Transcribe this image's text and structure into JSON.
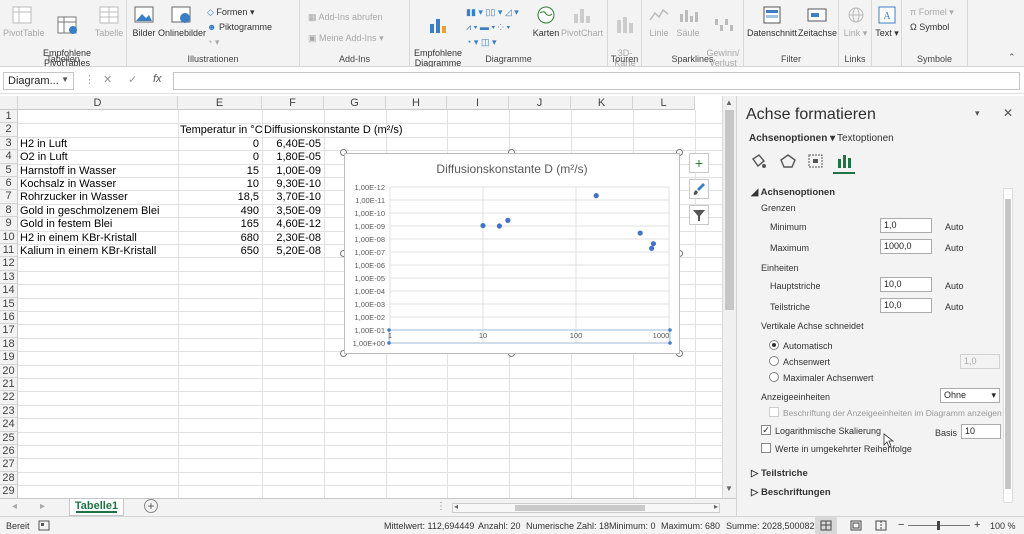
{
  "ribbon": {
    "tabellen": {
      "group": "Tabellen",
      "pivottable": "PivotTable",
      "empfohlene": "Empfohlene\nPivotTables",
      "tabelle": "Tabelle"
    },
    "illustrationen": {
      "group": "Illustrationen",
      "bilder": "Bilder",
      "onlinebilder": "Onlinebilder",
      "formen": "Formen",
      "piktogramme": "Piktogramme"
    },
    "addins": {
      "group": "Add-Ins",
      "abrufen": "Add-Ins abrufen",
      "meine": "Meine Add-Ins"
    },
    "diagramme": {
      "group": "Diagramme",
      "empfohlene": "Empfohlene\nDiagramme",
      "karten": "Karten",
      "pivotchart": "PivotChart"
    },
    "touren": {
      "group": "Touren",
      "karte3d": "3D-\nKarte"
    },
    "sparklines": {
      "group": "Sparklines",
      "linie": "Linie",
      "saeule": "Säule",
      "gewinn": "Gewinn/\nVerlust"
    },
    "filter": {
      "group": "Filter",
      "datenschnitt": "Datenschnitt",
      "zeitachse": "Zeitachse"
    },
    "links": {
      "group": "Links",
      "link": "Link"
    },
    "text": {
      "group": "",
      "text": "Text"
    },
    "symbole": {
      "group": "Symbole",
      "formel": "Formel",
      "symbol": "Symbol"
    }
  },
  "formula_bar": {
    "name_box": "Diagram...",
    "cancel": "✕",
    "enter": "✓",
    "fx": "fx",
    "value": ""
  },
  "columns": [
    "D",
    "E",
    "F",
    "G",
    "H",
    "I",
    "J",
    "K",
    "L"
  ],
  "rows": [
    "1",
    "2",
    "3",
    "4",
    "5",
    "6",
    "7",
    "8",
    "9",
    "10",
    "11",
    "12",
    "13",
    "14",
    "15",
    "16",
    "17",
    "18",
    "19",
    "20",
    "21",
    "22",
    "23",
    "24",
    "25",
    "26",
    "27",
    "28",
    "29"
  ],
  "table": {
    "header_e": "Temperatur in °C",
    "header_f": "Diffusionskonstante D (m²/s)",
    "data": [
      {
        "d": "H2 in Luft",
        "e": "0",
        "f": "6,40E-05"
      },
      {
        "d": "O2 in Luft",
        "e": "0",
        "f": "1,80E-05"
      },
      {
        "d": "Harnstoff in Wasser",
        "e": "15",
        "f": "1,00E-09"
      },
      {
        "d": "Kochsalz in Wasser",
        "e": "10",
        "f": "9,30E-10"
      },
      {
        "d": "Rohrzucker in Wasser",
        "e": "18,5",
        "f": "3,70E-10"
      },
      {
        "d": "Gold in geschmolzenem Blei",
        "e": "490",
        "f": "3,50E-09"
      },
      {
        "d": "Gold in festem Blei",
        "e": "165",
        "f": "4,60E-12"
      },
      {
        "d": "H2 in einem KBr-Kristall",
        "e": "680",
        "f": "2,30E-08"
      },
      {
        "d": "Kalium in einem KBr-Kristall",
        "e": "650",
        "f": "5,20E-08"
      }
    ]
  },
  "chart_data": {
    "type": "scatter",
    "title": "Diffusionskonstante D (m²/s)",
    "x_scale": "log",
    "x_base": 10,
    "x_lim": [
      1,
      1000
    ],
    "x_ticks": [
      "1",
      "10",
      "100",
      "1000"
    ],
    "y_scale": "log",
    "y_lim": [
      1e-12,
      1
    ],
    "y_reversed": true,
    "y_ticks": [
      "1,00E-12",
      "1,00E-11",
      "1,00E-10",
      "1,00E-09",
      "1,00E-08",
      "1,00E-07",
      "1,00E-06",
      "1,00E-05",
      "1,00E-04",
      "1,00E-03",
      "1,00E-02",
      "1,00E-01",
      "1,00E+00"
    ],
    "gridlines": true,
    "legend": "none",
    "x": [
      15,
      10,
      18.5,
      490,
      165,
      680,
      650
    ],
    "y": [
      1e-09,
      9.3e-10,
      3.7e-10,
      3.5e-09,
      4.6e-12,
      2.3e-08,
      5.2e-08
    ],
    "color": "#4472c4"
  },
  "chart_buttons": {
    "add": "+",
    "style": "brush-icon",
    "filter": "filter-icon"
  },
  "sheet": {
    "tab": "Tabelle1",
    "add": "+"
  },
  "pane": {
    "title": "Achse formatieren",
    "tab_achsenoptionen": "Achsenoptionen",
    "tab_textoptionen": "Textoptionen",
    "section": "Achsenoptionen",
    "grenzen": "Grenzen",
    "minimum_label": "Minimum",
    "minimum_value": "1,0",
    "minimum_mode": "Auto",
    "maximum_label": "Maximum",
    "maximum_value": "1000,0",
    "maximum_mode": "Auto",
    "einheiten": "Einheiten",
    "haupt_label": "Hauptstriche",
    "haupt_value": "10,0",
    "haupt_mode": "Auto",
    "teil_label": "Teilstriche",
    "teil_value": "10,0",
    "teil_mode": "Auto",
    "vachse": "Vertikale Achse schneidet",
    "r_auto": "Automatisch",
    "r_wert": "Achsenwert",
    "r_wert_value": "1,0",
    "r_max": "Maximaler Achsenwert",
    "anzeige_label": "Anzeigeeinheiten",
    "anzeige_value": "Ohne",
    "beschriftung_check": "Beschriftung der Anzeigeeinheiten im Diagramm anzeigen",
    "log_check": "Logarithmische Skalierung",
    "basis_label": "Basis",
    "basis_value": "10",
    "reverse_check": "Werte in umgekehrter Reihenfolge",
    "teilstriche_section": "Teilstriche",
    "beschriftungen_section": "Beschriftungen"
  },
  "status": {
    "mode": "Bereit",
    "mittelwert": "Mittelwert: 112,694449",
    "anzahl": "Anzahl: 20",
    "numerische": "Numerische Zahl: 18",
    "minimum": "Minimum: 0",
    "maximum": "Maximum: 680",
    "summe": "Summe: 2028,500082",
    "zoom": "100 %"
  }
}
